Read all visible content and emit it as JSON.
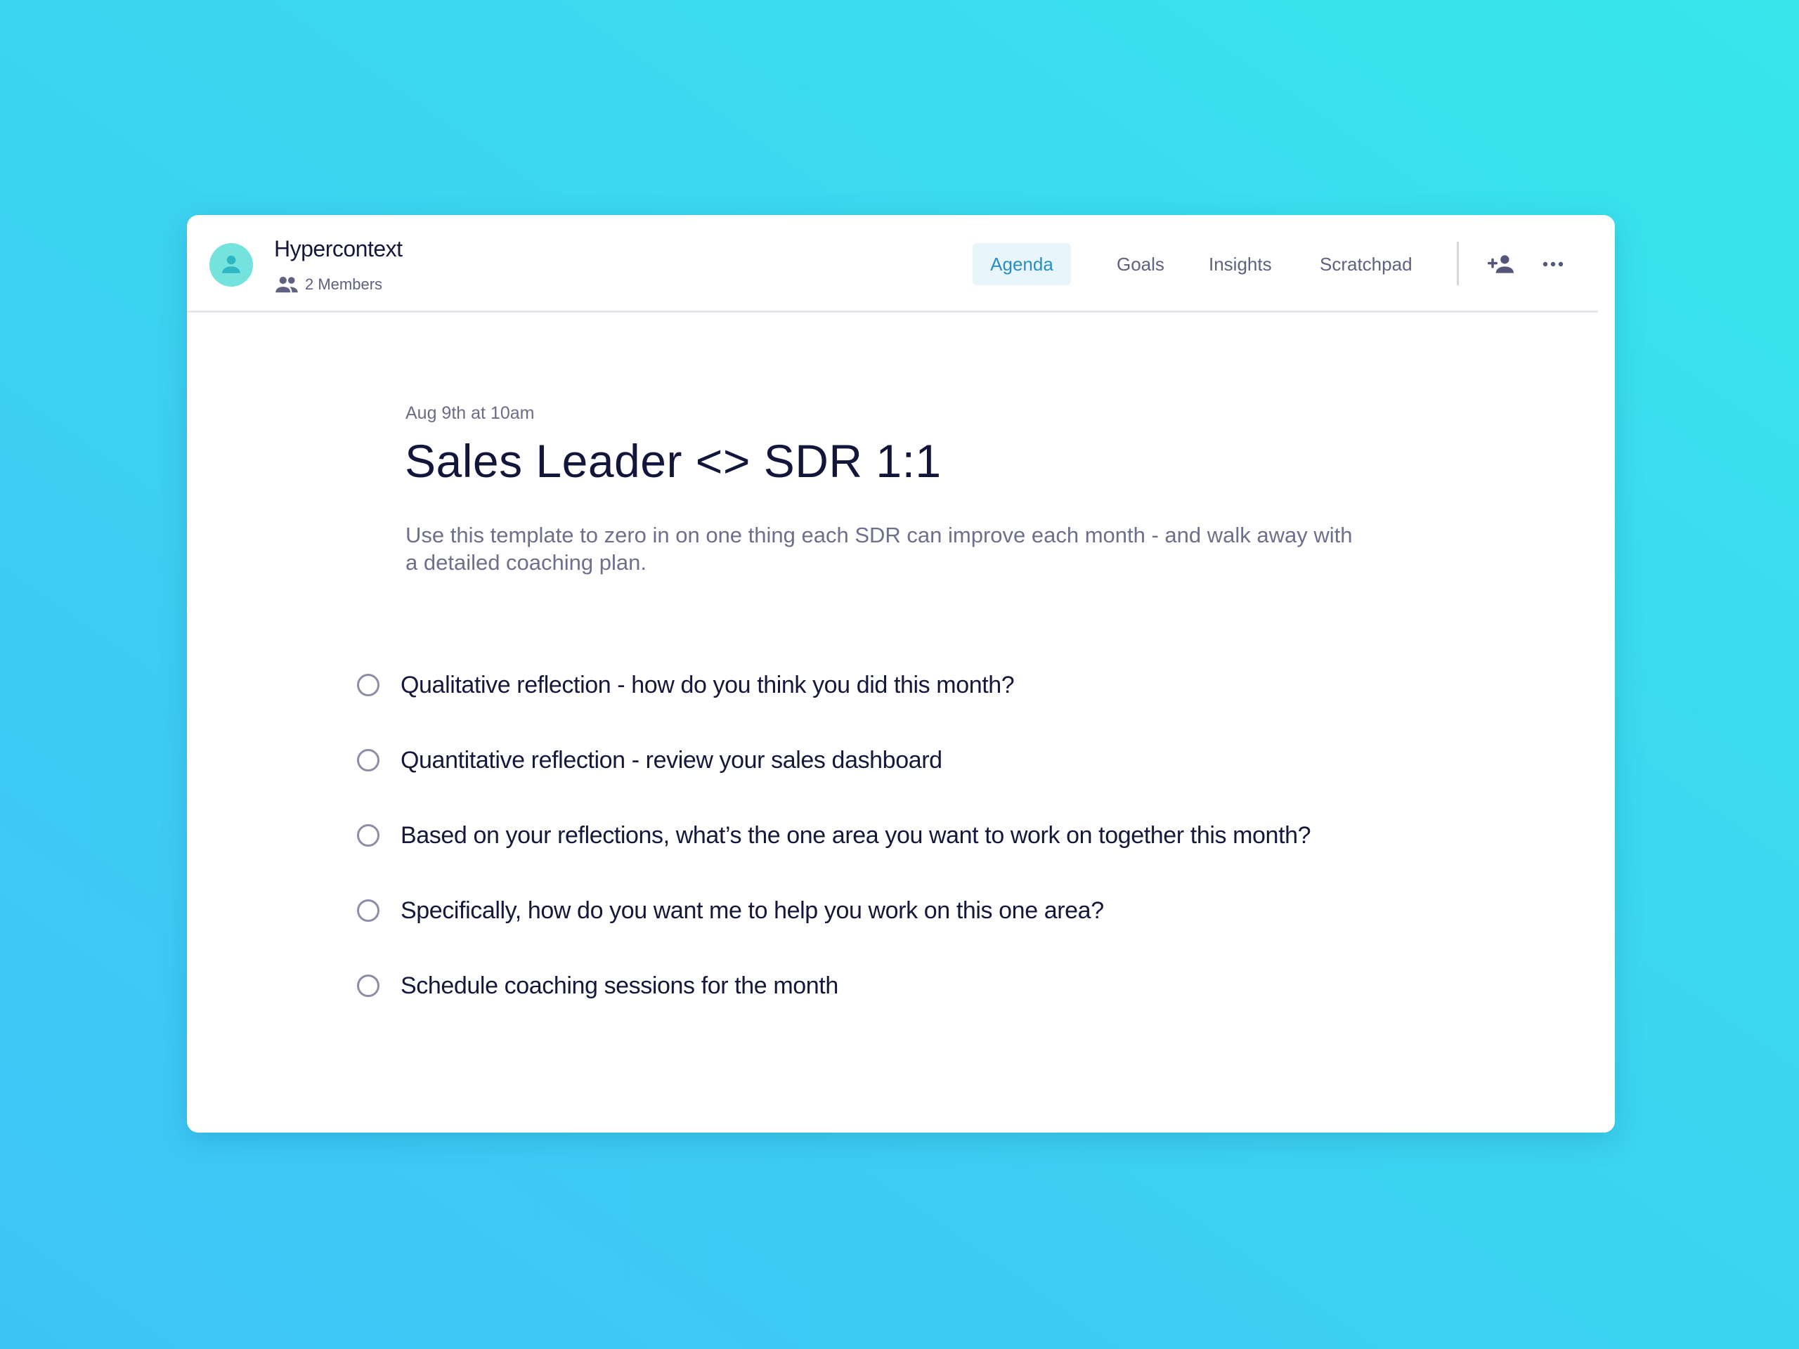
{
  "header": {
    "workspace_name": "Hypercontext",
    "members_label": "2 Members",
    "tabs": [
      {
        "label": "Agenda",
        "active": true
      },
      {
        "label": "Goals",
        "active": false
      },
      {
        "label": "Insights",
        "active": false
      },
      {
        "label": "Scratchpad",
        "active": false
      }
    ],
    "icons": {
      "avatar": "person-icon",
      "members": "group-icon",
      "add_member": "person-add-icon",
      "more": "more-horizontal-icon"
    }
  },
  "meeting": {
    "date": "Aug 9th at 10am",
    "title": "Sales Leader <> SDR 1:1",
    "description": "Use this template to zero in on one thing each SDR can improve each month - and walk away with a detailed coaching plan."
  },
  "agenda_items": [
    "Qualitative reflection - how do you think you did this month?",
    "Quantitative reflection - review your sales dashboard",
    "Based on your reflections, what’s the one area you want to work on together this month?",
    "Specifically, how do you want me to help you work on this one area?",
    "Schedule coaching sessions for the month"
  ],
  "colors": {
    "background_start": "#38e6ec",
    "background_end": "#3dc4f7",
    "accent": "#2a8ec2",
    "avatar": "#74e2dd",
    "text_primary": "#15183a",
    "text_secondary": "#6d6f8c"
  }
}
